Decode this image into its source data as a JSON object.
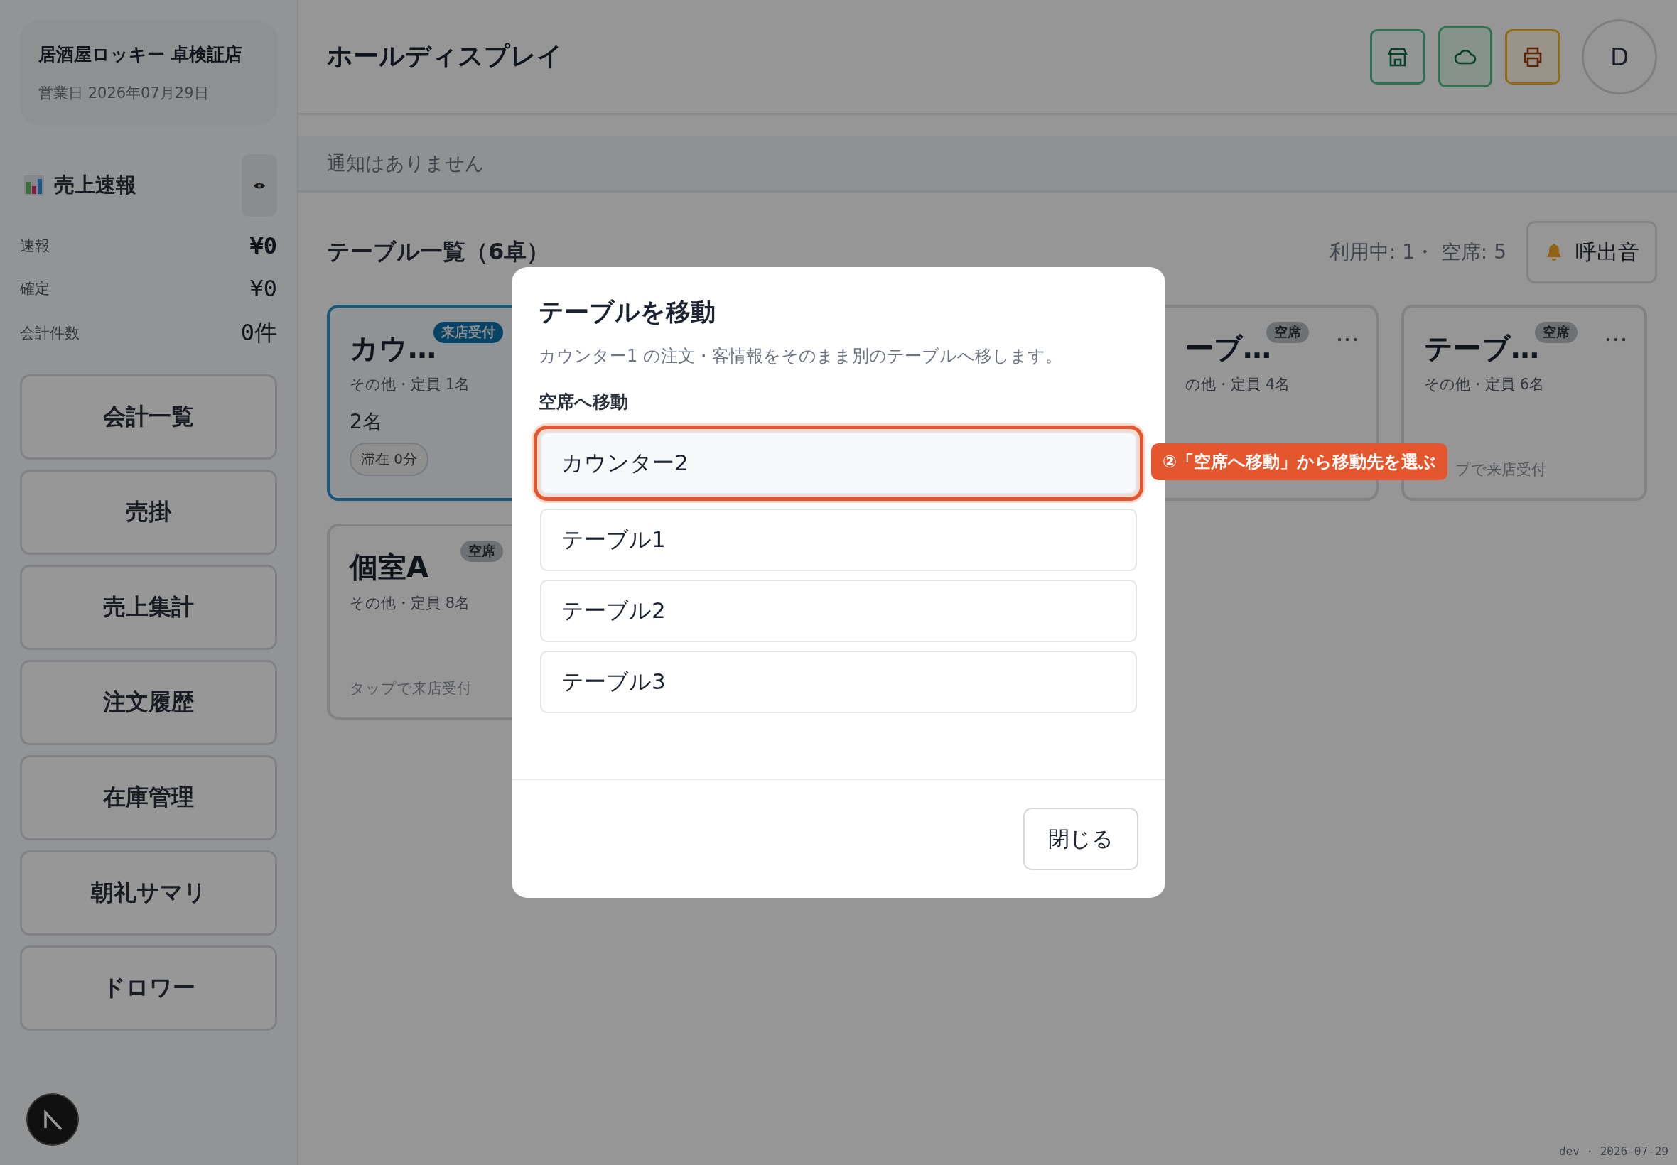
{
  "sidebar": {
    "store": {
      "name": "居酒屋ロッキー 卓検証店",
      "business_date": "営業日 2026年07月29日"
    },
    "sales": {
      "title": "売上速報",
      "rows": [
        {
          "label": "速報",
          "value": "¥0",
          "bold": true
        },
        {
          "label": "確定",
          "value": "¥0",
          "bold": false
        },
        {
          "label": "会計件数",
          "value": "0件",
          "bold": false
        }
      ]
    },
    "nav": [
      "会計一覧",
      "売掛",
      "売上集計",
      "注文履歴",
      "在庫管理",
      "朝礼サマリ",
      "ドロワー"
    ]
  },
  "header": {
    "title": "ホールディスプレイ",
    "avatar": "D"
  },
  "notice": "通知はありません",
  "tables": {
    "title": "テーブル一覧（6卓）",
    "summary": "利用中: 1・ 空席: 5",
    "call_button": "呼出音",
    "cards": [
      {
        "name": "カウ…",
        "meta": "その他・定員 1名",
        "status": {
          "label": "来店受付",
          "kind": "reception"
        },
        "guests": "2名",
        "stay": "滞在 0分"
      },
      {
        "name": "ーブ…",
        "meta": "の他・定員 4名",
        "status": {
          "label": "空席",
          "kind": "vacant"
        },
        "menu": true
      },
      {
        "name": "テーブ…",
        "meta": "その他・定員 6名",
        "status": {
          "label": "空席",
          "kind": "vacant"
        },
        "footer": "プで来店受付",
        "menu": true
      },
      {
        "name": "個室A",
        "meta": "その他・定員 8名",
        "status": {
          "label": "空席",
          "kind": "vacant"
        },
        "footer": "タップで来店受付"
      }
    ]
  },
  "dialog": {
    "title": "テーブルを移動",
    "description": "カウンター1 の注文・客情報をそのまま別のテーブルへ移します。",
    "section_label": "空席へ移動",
    "options": [
      {
        "label": "カウンター2",
        "selected": true
      },
      {
        "label": "テーブル1",
        "selected": false
      },
      {
        "label": "テーブル2",
        "selected": false
      },
      {
        "label": "テーブル3",
        "selected": false
      }
    ],
    "close_button": "閉じる"
  },
  "callout": "②「空席へ移動」から移動先を選ぶ",
  "footer": "dev · 2026-07-29"
}
